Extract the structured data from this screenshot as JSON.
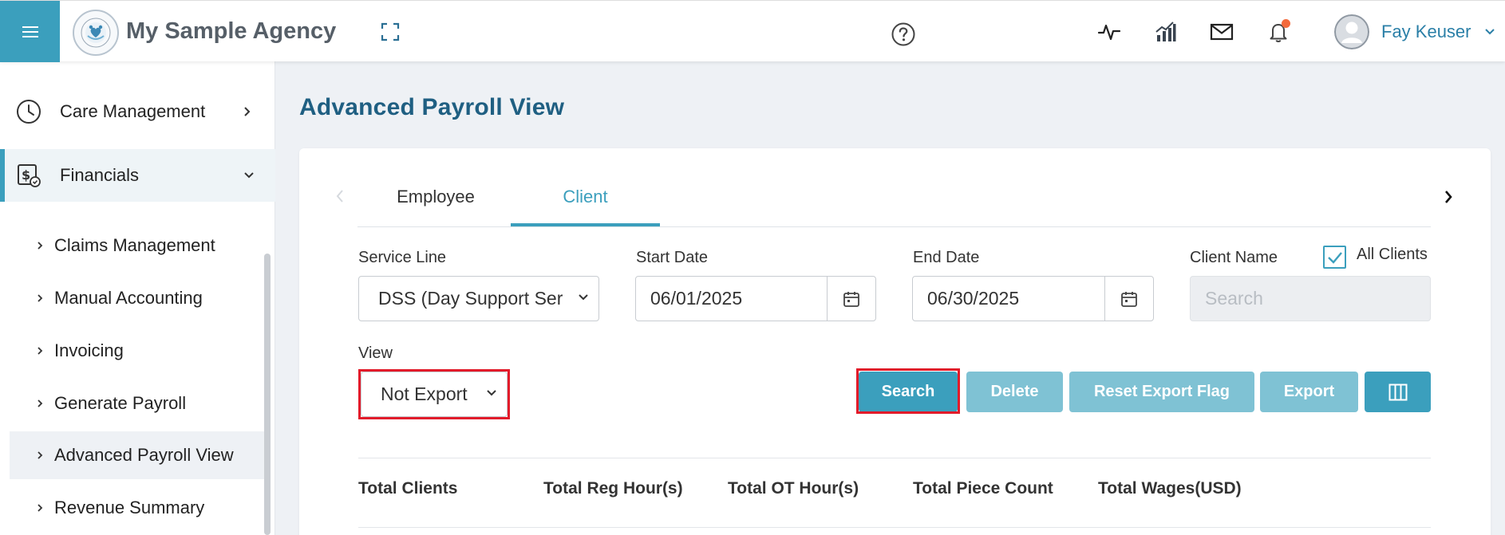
{
  "header": {
    "agency_name": "My Sample Agency",
    "user_name": "Fay Keuser",
    "has_notification": true,
    "accent_color": "#3b9fbd"
  },
  "sidebar": {
    "main_items": [
      {
        "label": "Care Management",
        "icon": "clock-icon",
        "expanded": false
      },
      {
        "label": "Financials",
        "icon": "dollar-document-icon",
        "expanded": true
      }
    ],
    "sub_items": [
      {
        "label": "Claims Management"
      },
      {
        "label": "Manual Accounting"
      },
      {
        "label": "Invoicing"
      },
      {
        "label": "Generate Payroll"
      },
      {
        "label": "Advanced Payroll View",
        "selected": true
      },
      {
        "label": "Revenue Summary"
      }
    ]
  },
  "main": {
    "page_title": "Advanced Payroll View",
    "tabs": [
      {
        "label": "Employee",
        "active": false
      },
      {
        "label": "Client",
        "active": true
      }
    ],
    "filters": {
      "service_line_label": "Service Line",
      "service_line_value": "DSS (Day Support Ser",
      "start_date_label": "Start Date",
      "start_date_value": "06/01/2025",
      "end_date_label": "End Date",
      "end_date_value": "06/30/2025",
      "client_name_label": "Client Name",
      "client_name_placeholder": "Search",
      "all_clients_label": "All Clients",
      "all_clients_checked": true,
      "view_label": "View",
      "view_value": "Not Export"
    },
    "buttons": {
      "search": "Search",
      "delete": "Delete",
      "reset_export_flag": "Reset Export Flag",
      "export": "Export"
    },
    "summary_headers": [
      "Total Clients",
      "Total Reg Hour(s)",
      "Total OT Hour(s)",
      "Total Piece Count",
      "Total Wages(USD)"
    ]
  }
}
